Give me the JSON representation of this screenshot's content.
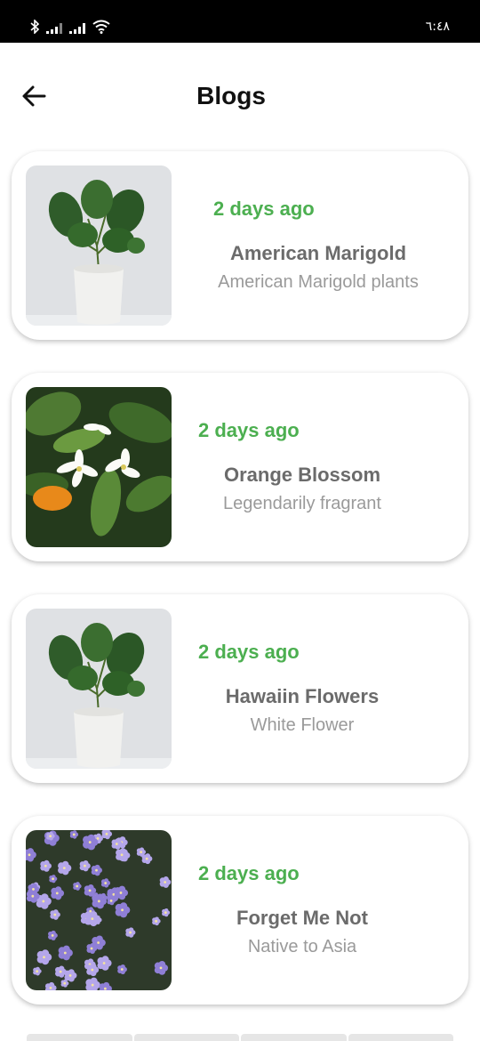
{
  "status_bar": {
    "time": "٦:٤٨",
    "icons": [
      "bluetooth-icon",
      "signal-icon",
      "signal-icon",
      "wifi-icon"
    ]
  },
  "header": {
    "title": "Blogs",
    "back_icon": "arrow-left-icon"
  },
  "blogs": [
    {
      "time_ago": "2 days ago",
      "title": "American Marigold",
      "subtitle": "American Marigold plants",
      "image": "potted-monstera-plant"
    },
    {
      "time_ago": "2 days ago",
      "title": "Orange Blossom",
      "subtitle": "Legendarily fragrant",
      "image": "white-orange-blossom-flowers"
    },
    {
      "time_ago": "2 days ago",
      "title": "Hawaiin Flowers",
      "subtitle": "White Flower",
      "image": "potted-monstera-plant"
    },
    {
      "time_ago": "2 days ago",
      "title": "Forget Me Not",
      "subtitle": "Native to Asia",
      "image": "purple-forget-me-not-flowers"
    }
  ],
  "colors": {
    "accent_green": "#4caf50",
    "title_gray": "#6b6b6b",
    "subtitle_gray": "#9a9a9a"
  }
}
